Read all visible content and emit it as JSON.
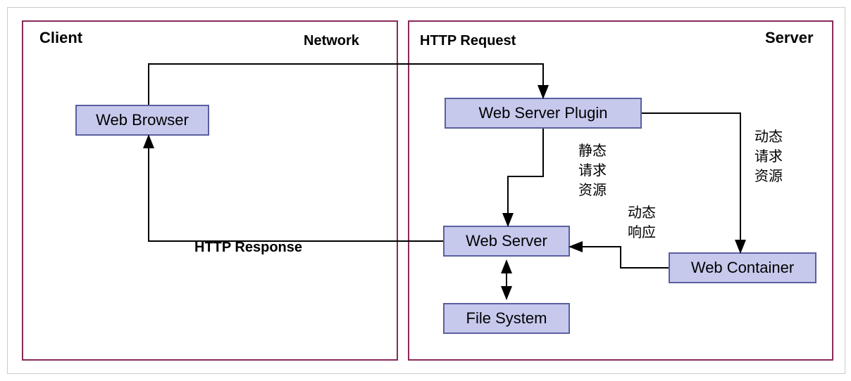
{
  "containers": {
    "client": {
      "label": "Client"
    },
    "server": {
      "label": "Server"
    }
  },
  "nodes": {
    "web_browser": {
      "label": "Web Browser"
    },
    "web_server_plugin": {
      "label": "Web Server Plugin"
    },
    "web_server": {
      "label": "Web Server"
    },
    "web_container": {
      "label": "Web Container"
    },
    "file_system": {
      "label": "File System"
    }
  },
  "edge_labels": {
    "network": "Network",
    "http_request": "HTTP Request",
    "http_response": "HTTP Response",
    "static_request": "静态\n请求\n资源",
    "dynamic_request": "动态\n请求\n资源",
    "dynamic_response": "动态\n响应"
  }
}
